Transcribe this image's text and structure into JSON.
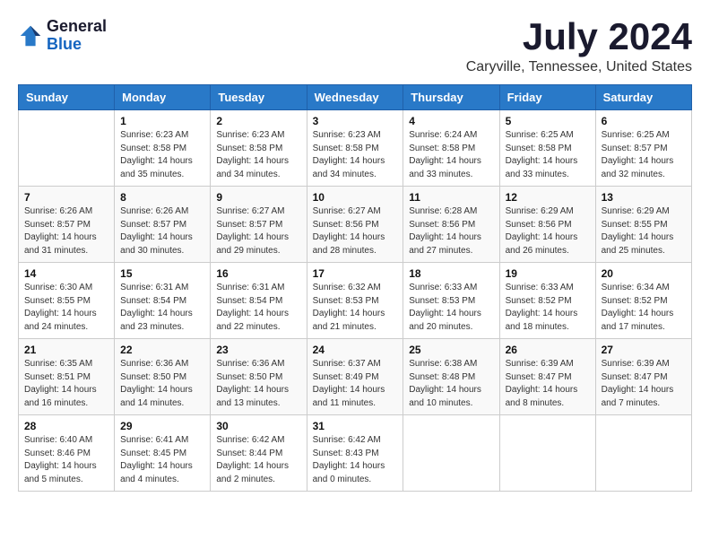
{
  "logo": {
    "general": "General",
    "blue": "Blue"
  },
  "title": "July 2024",
  "location": "Caryville, Tennessee, United States",
  "days_header": [
    "Sunday",
    "Monday",
    "Tuesday",
    "Wednesday",
    "Thursday",
    "Friday",
    "Saturday"
  ],
  "weeks": [
    [
      {
        "day": "",
        "info": ""
      },
      {
        "day": "1",
        "info": "Sunrise: 6:23 AM\nSunset: 8:58 PM\nDaylight: 14 hours\nand 35 minutes."
      },
      {
        "day": "2",
        "info": "Sunrise: 6:23 AM\nSunset: 8:58 PM\nDaylight: 14 hours\nand 34 minutes."
      },
      {
        "day": "3",
        "info": "Sunrise: 6:23 AM\nSunset: 8:58 PM\nDaylight: 14 hours\nand 34 minutes."
      },
      {
        "day": "4",
        "info": "Sunrise: 6:24 AM\nSunset: 8:58 PM\nDaylight: 14 hours\nand 33 minutes."
      },
      {
        "day": "5",
        "info": "Sunrise: 6:25 AM\nSunset: 8:58 PM\nDaylight: 14 hours\nand 33 minutes."
      },
      {
        "day": "6",
        "info": "Sunrise: 6:25 AM\nSunset: 8:57 PM\nDaylight: 14 hours\nand 32 minutes."
      }
    ],
    [
      {
        "day": "7",
        "info": "Sunrise: 6:26 AM\nSunset: 8:57 PM\nDaylight: 14 hours\nand 31 minutes."
      },
      {
        "day": "8",
        "info": "Sunrise: 6:26 AM\nSunset: 8:57 PM\nDaylight: 14 hours\nand 30 minutes."
      },
      {
        "day": "9",
        "info": "Sunrise: 6:27 AM\nSunset: 8:57 PM\nDaylight: 14 hours\nand 29 minutes."
      },
      {
        "day": "10",
        "info": "Sunrise: 6:27 AM\nSunset: 8:56 PM\nDaylight: 14 hours\nand 28 minutes."
      },
      {
        "day": "11",
        "info": "Sunrise: 6:28 AM\nSunset: 8:56 PM\nDaylight: 14 hours\nand 27 minutes."
      },
      {
        "day": "12",
        "info": "Sunrise: 6:29 AM\nSunset: 8:56 PM\nDaylight: 14 hours\nand 26 minutes."
      },
      {
        "day": "13",
        "info": "Sunrise: 6:29 AM\nSunset: 8:55 PM\nDaylight: 14 hours\nand 25 minutes."
      }
    ],
    [
      {
        "day": "14",
        "info": "Sunrise: 6:30 AM\nSunset: 8:55 PM\nDaylight: 14 hours\nand 24 minutes."
      },
      {
        "day": "15",
        "info": "Sunrise: 6:31 AM\nSunset: 8:54 PM\nDaylight: 14 hours\nand 23 minutes."
      },
      {
        "day": "16",
        "info": "Sunrise: 6:31 AM\nSunset: 8:54 PM\nDaylight: 14 hours\nand 22 minutes."
      },
      {
        "day": "17",
        "info": "Sunrise: 6:32 AM\nSunset: 8:53 PM\nDaylight: 14 hours\nand 21 minutes."
      },
      {
        "day": "18",
        "info": "Sunrise: 6:33 AM\nSunset: 8:53 PM\nDaylight: 14 hours\nand 20 minutes."
      },
      {
        "day": "19",
        "info": "Sunrise: 6:33 AM\nSunset: 8:52 PM\nDaylight: 14 hours\nand 18 minutes."
      },
      {
        "day": "20",
        "info": "Sunrise: 6:34 AM\nSunset: 8:52 PM\nDaylight: 14 hours\nand 17 minutes."
      }
    ],
    [
      {
        "day": "21",
        "info": "Sunrise: 6:35 AM\nSunset: 8:51 PM\nDaylight: 14 hours\nand 16 minutes."
      },
      {
        "day": "22",
        "info": "Sunrise: 6:36 AM\nSunset: 8:50 PM\nDaylight: 14 hours\nand 14 minutes."
      },
      {
        "day": "23",
        "info": "Sunrise: 6:36 AM\nSunset: 8:50 PM\nDaylight: 14 hours\nand 13 minutes."
      },
      {
        "day": "24",
        "info": "Sunrise: 6:37 AM\nSunset: 8:49 PM\nDaylight: 14 hours\nand 11 minutes."
      },
      {
        "day": "25",
        "info": "Sunrise: 6:38 AM\nSunset: 8:48 PM\nDaylight: 14 hours\nand 10 minutes."
      },
      {
        "day": "26",
        "info": "Sunrise: 6:39 AM\nSunset: 8:47 PM\nDaylight: 14 hours\nand 8 minutes."
      },
      {
        "day": "27",
        "info": "Sunrise: 6:39 AM\nSunset: 8:47 PM\nDaylight: 14 hours\nand 7 minutes."
      }
    ],
    [
      {
        "day": "28",
        "info": "Sunrise: 6:40 AM\nSunset: 8:46 PM\nDaylight: 14 hours\nand 5 minutes."
      },
      {
        "day": "29",
        "info": "Sunrise: 6:41 AM\nSunset: 8:45 PM\nDaylight: 14 hours\nand 4 minutes."
      },
      {
        "day": "30",
        "info": "Sunrise: 6:42 AM\nSunset: 8:44 PM\nDaylight: 14 hours\nand 2 minutes."
      },
      {
        "day": "31",
        "info": "Sunrise: 6:42 AM\nSunset: 8:43 PM\nDaylight: 14 hours\nand 0 minutes."
      },
      {
        "day": "",
        "info": ""
      },
      {
        "day": "",
        "info": ""
      },
      {
        "day": "",
        "info": ""
      }
    ]
  ]
}
